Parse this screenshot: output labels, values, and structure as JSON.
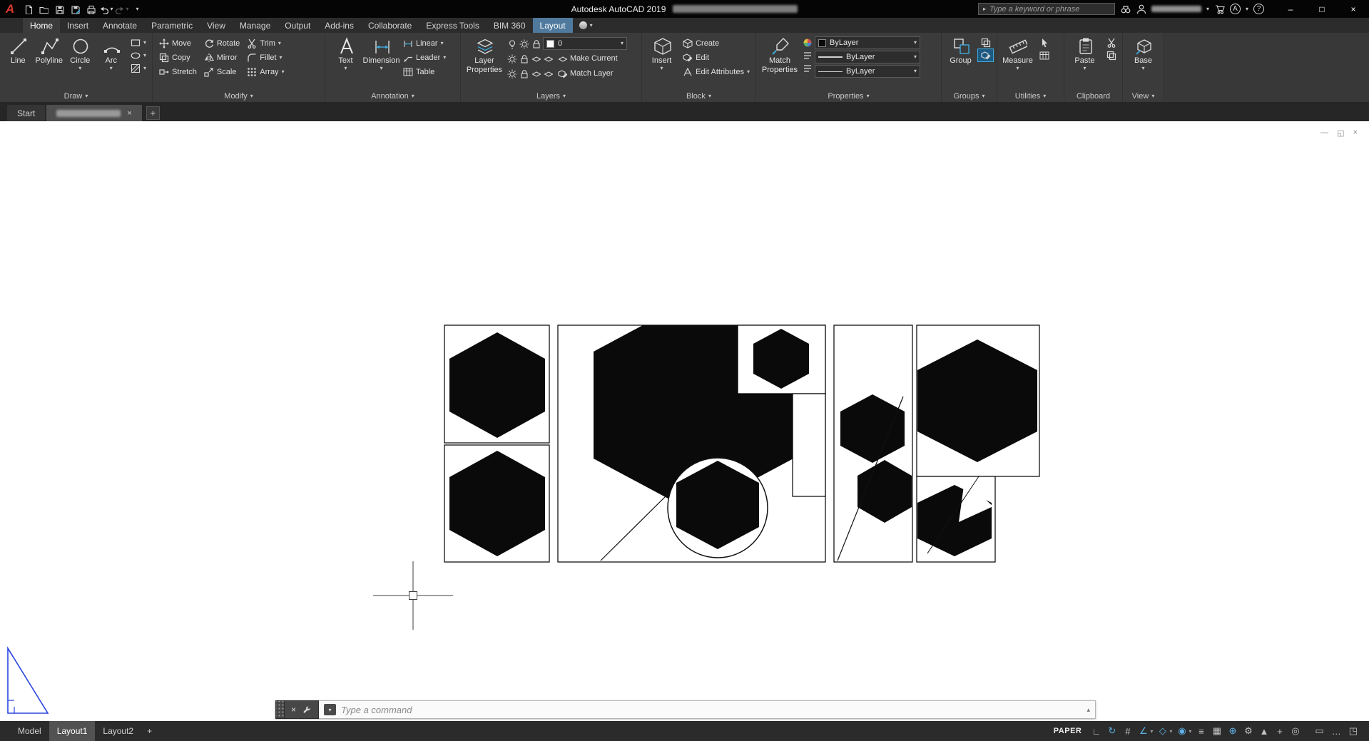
{
  "glyphs": {
    "caret_down": "▾",
    "caret_right": "▸",
    "caret_up": "▴",
    "close": "×",
    "minimize": "–",
    "maximize": "□",
    "restore": "◱",
    "minus": "—",
    "plus": "+"
  },
  "titlebar": {
    "logo_letter": "A",
    "app_title": "Autodesk AutoCAD 2019",
    "search_placeholder": "Type a keyword or phrase",
    "share_glyph": "A",
    "help_glyph": "?"
  },
  "tabs": {
    "items": [
      "Home",
      "Insert",
      "Annotate",
      "Parametric",
      "View",
      "Manage",
      "Output",
      "Add-ins",
      "Collaborate",
      "Express Tools",
      "BIM 360",
      "Layout"
    ]
  },
  "ribbon": {
    "draw": {
      "label": "Draw",
      "line": "Line",
      "polyline": "Polyline",
      "circle": "Circle",
      "arc": "Arc"
    },
    "modify": {
      "label": "Modify",
      "move": "Move",
      "copy": "Copy",
      "stretch": "Stretch",
      "rotate": "Rotate",
      "mirror": "Mirror",
      "scale": "Scale",
      "trim": "Trim",
      "fillet": "Fillet",
      "array": "Array"
    },
    "annotation": {
      "label": "Annotation",
      "text": "Text",
      "dimension": "Dimension",
      "linear": "Linear",
      "leader": "Leader",
      "table": "Table"
    },
    "layers": {
      "label": "Layers",
      "layer_properties": "Layer Properties",
      "current_layer": "0",
      "make_current": "Make Current",
      "match_layer": "Match Layer"
    },
    "block": {
      "label": "Block",
      "insert": "Insert",
      "create": "Create",
      "edit": "Edit",
      "edit_attributes": "Edit Attributes"
    },
    "properties": {
      "label": "Properties",
      "match_properties": "Match Properties",
      "color": "ByLayer",
      "linetype": "ByLayer",
      "lineweight": "ByLayer"
    },
    "groups": {
      "label": "Groups",
      "group": "Group"
    },
    "utilities": {
      "label": "Utilities",
      "measure": "Measure"
    },
    "clipboard": {
      "label": "Clipboard",
      "paste": "Paste"
    },
    "view": {
      "label": "View",
      "base": "Base"
    }
  },
  "file_tabs": {
    "start": "Start"
  },
  "command_line": {
    "placeholder": "Type a command"
  },
  "statusbar": {
    "model": "Model",
    "layout1": "Layout1",
    "layout2": "Layout2",
    "paper": "PAPER",
    "icons": [
      {
        "name": "ucs-icon",
        "glyph": "∟",
        "active": false
      },
      {
        "name": "annotation-monitor-icon",
        "glyph": "↻",
        "active": true
      },
      {
        "name": "grid-icon",
        "glyph": "#",
        "active": false
      },
      {
        "name": "polar-tracking-icon",
        "glyph": "∠",
        "active": true
      },
      {
        "name": "isodraft-icon",
        "glyph": "◇",
        "active": true
      },
      {
        "name": "osnap-icon",
        "glyph": "◉",
        "active": true
      },
      {
        "name": "lineweight-icon",
        "glyph": "≡",
        "active": false
      },
      {
        "name": "transparency-icon",
        "glyph": "▦",
        "active": false
      },
      {
        "name": "dynamic-input-icon",
        "glyph": "⊕",
        "active": true
      },
      {
        "name": "customization-gear-icon",
        "glyph": "⚙",
        "active": false
      },
      {
        "name": "annotation-visibility-icon",
        "glyph": "▲",
        "active": false
      },
      {
        "name": "add-scales-icon",
        "glyph": "+",
        "active": false
      },
      {
        "name": "isolate-objects-icon",
        "glyph": "◎",
        "active": false
      }
    ],
    "right_icons": [
      {
        "name": "performance-monitor-icon",
        "glyph": "▭"
      },
      {
        "name": "feedback-icon",
        "glyph": "…"
      },
      {
        "name": "clean-screen-icon",
        "glyph": "◳"
      }
    ]
  }
}
